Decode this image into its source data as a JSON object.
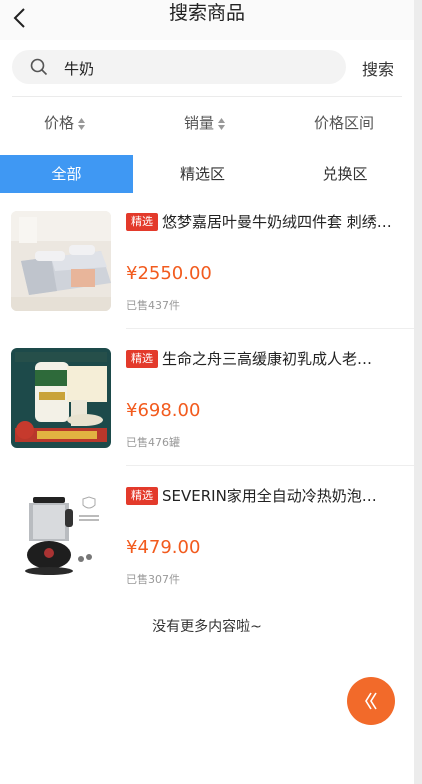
{
  "header": {
    "title": "搜索商品"
  },
  "search": {
    "query": "牛奶",
    "button_label": "搜索"
  },
  "sort": {
    "price": "价格",
    "sales": "销量",
    "price_range": "价格区间"
  },
  "tabs": [
    {
      "label": "全部",
      "active": true
    },
    {
      "label": "精选区",
      "active": false
    },
    {
      "label": "兑换区",
      "active": false
    }
  ],
  "products": [
    {
      "badge": "精选",
      "name": "悠梦嘉居叶曼牛奶绒四件套 刺绣…",
      "price": "¥2550.00",
      "sold": "已售437件"
    },
    {
      "badge": "精选",
      "name": "生命之舟三高缓康初乳成人老…",
      "price": "¥698.00",
      "sold": "已售476罐"
    },
    {
      "badge": "精选",
      "name": "SEVERIN家用全自动冷热奶泡…",
      "price": "¥479.00",
      "sold": "已售307件"
    }
  ],
  "footer": {
    "no_more": "没有更多内容啦~"
  },
  "colors": {
    "accent": "#3f98f3",
    "price": "#f25b1e",
    "badge": "#e33a2b",
    "fab": "#f26a2a"
  },
  "icons": {
    "back": "chevron-left-icon",
    "search": "search-icon",
    "fab": "double-chevron-left-icon"
  }
}
